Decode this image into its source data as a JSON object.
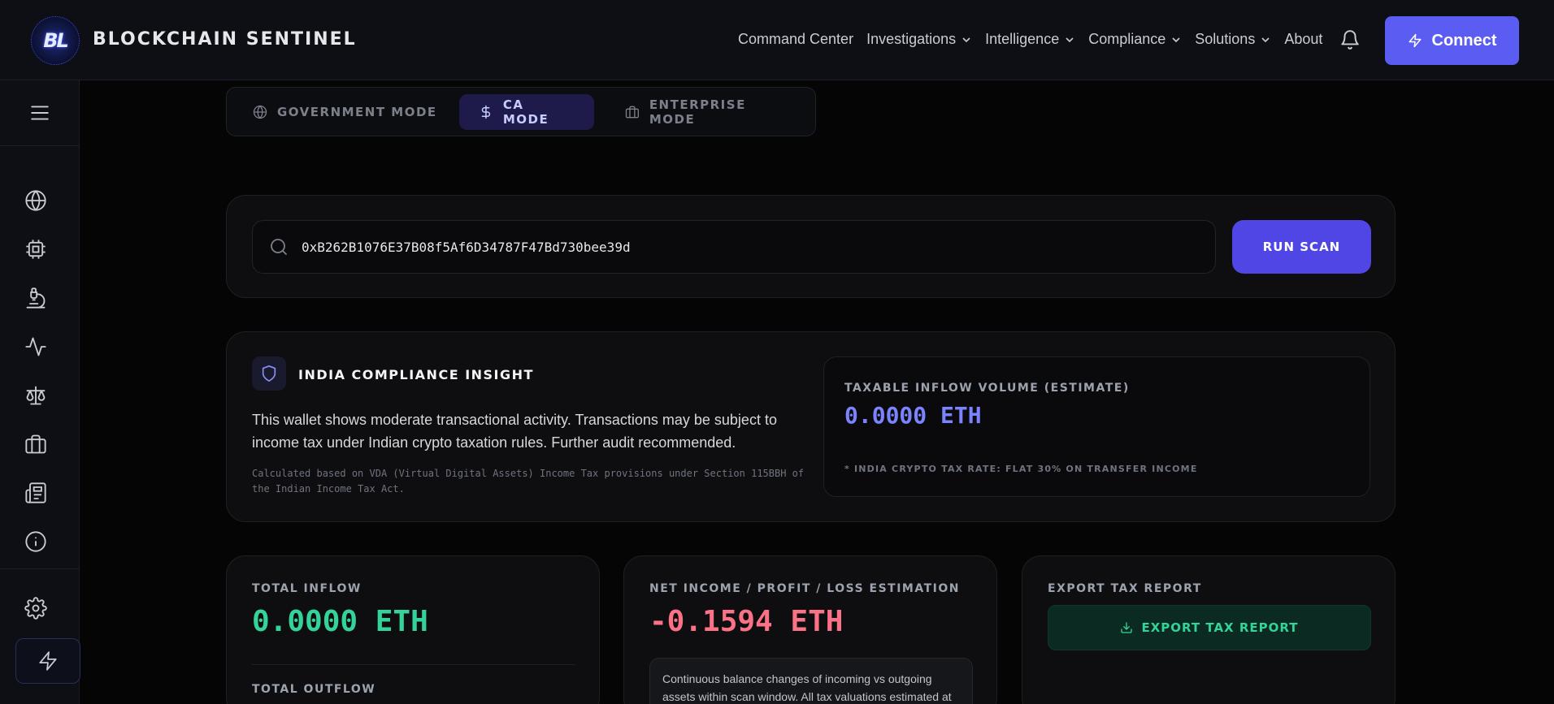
{
  "header": {
    "logo_text": "BL",
    "brand": "BLOCKCHAIN SENTINEL",
    "nav": [
      {
        "label": "Command Center",
        "dropdown": false
      },
      {
        "label": "Investigations",
        "dropdown": true
      },
      {
        "label": "Intelligence",
        "dropdown": true
      },
      {
        "label": "Compliance",
        "dropdown": true
      },
      {
        "label": "Solutions",
        "dropdown": true
      },
      {
        "label": "About",
        "dropdown": false
      }
    ],
    "connect_label": "Connect",
    "accent": "#5b5cf2"
  },
  "sidebar": {
    "items": [
      "menu-icon",
      "globe-icon",
      "chip-icon",
      "microscope-icon",
      "activity-icon",
      "scale-icon",
      "briefcase-icon",
      "newspaper-icon",
      "info-icon",
      "gear-icon",
      "bolt-icon"
    ]
  },
  "modes": {
    "items": [
      {
        "label": "GOVERNMENT MODE",
        "icon": "globe-icon",
        "active": false
      },
      {
        "label": "CA MODE",
        "icon": "dollar-icon",
        "active": true
      },
      {
        "label": "ENTERPRISE MODE",
        "icon": "briefcase-icon",
        "active": false
      }
    ]
  },
  "search": {
    "value": "0xB262B1076E37B08f5Af6D34787F47Bd730bee39d",
    "button_label": "RUN SCAN"
  },
  "insight": {
    "title": "INDIA COMPLIANCE INSIGHT",
    "text": "This wallet shows moderate transactional activity. Transactions may be subject to income tax under Indian crypto taxation rules. Further audit recommended.",
    "note": "Calculated based on VDA (Virtual Digital Assets) Income Tax provisions under Section 115BBH of the Indian Income Tax Act.",
    "tax_label": "TAXABLE INFLOW VOLUME (ESTIMATE)",
    "tax_value": "0.0000 ETH",
    "tax_footnote": "* INDIA CRYPTO TAX RATE: FLAT 30% ON TRANSFER INCOME"
  },
  "stats": {
    "inflow_label": "TOTAL INFLOW",
    "inflow_value": "0.0000 ETH",
    "outflow_label": "TOTAL OUTFLOW",
    "net_label": "NET INCOME / PROFIT / LOSS ESTIMATION",
    "net_value": "-0.1594 ETH",
    "net_note": "Continuous balance changes of incoming vs outgoing assets within scan window. All tax valuations estimated at",
    "export_label": "EXPORT TAX REPORT",
    "export_button": "EXPORT TAX REPORT",
    "colors": {
      "inflow": "#34d399",
      "net": "#fb7185"
    }
  }
}
